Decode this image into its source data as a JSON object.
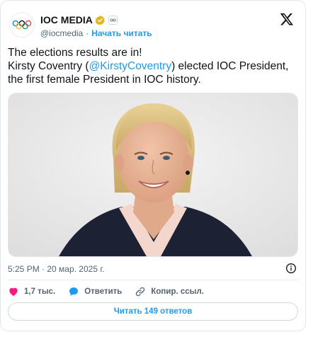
{
  "header": {
    "display_name": "IOC MEDIA",
    "handle": "@iocmedia",
    "separator": "·",
    "follow_label": "Начать читать"
  },
  "tweet": {
    "line1": "The elections results are in!",
    "line2_prefix": "Kirsty Coventry (",
    "mention": "@KirstyCoventry",
    "line2_suffix": ") elected IOC President,",
    "line3": "the first female President in IOC history."
  },
  "meta": {
    "timestamp": "5:25 PM · 20 мар. 2025 г."
  },
  "actions": {
    "likes": "1,7 тыс.",
    "reply_label": "Ответить",
    "copy_label": "Копир. ссыл."
  },
  "read_replies_label": "Читать 149 ответов",
  "colors": {
    "accent": "#1d9bf0",
    "like": "#f91880",
    "text": "#0f1419",
    "muted": "#536471"
  },
  "icons": [
    "olympic-rings-icon",
    "verified-badge-icon",
    "affiliate-badge-icon",
    "x-logo-icon",
    "info-icon",
    "heart-icon",
    "reply-bubble-icon",
    "link-icon"
  ]
}
